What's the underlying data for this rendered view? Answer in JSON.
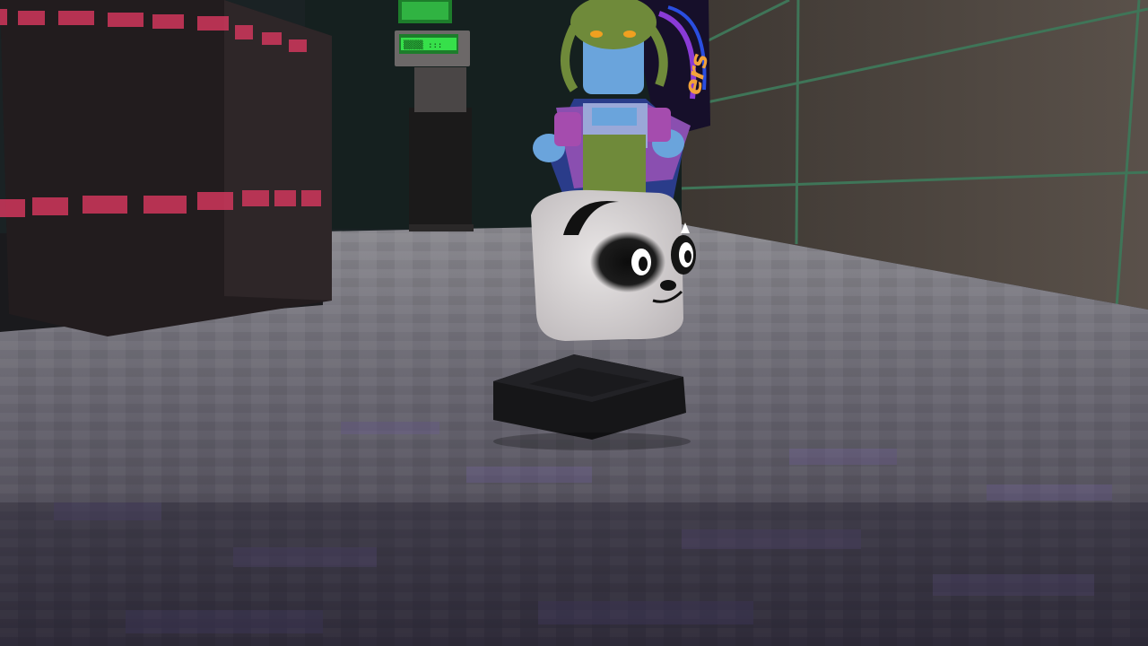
{
  "scene": {
    "poster_fragment_text": "ers",
    "monitor_readout": "▒▒▒▒ :::"
  },
  "colors": {
    "floor_light": "#7b7a82",
    "floor_dark": "#3a3842",
    "floor_purple": "#5e5378",
    "wall_right": "#4a423c",
    "wall_green_line": "#3d6b52",
    "pillar_left": "#231d1f",
    "pillar_stripe": "#d23a5f",
    "back_wall": "#1c2a2c",
    "monitor_green": "#37e84b",
    "panda_white": "#d9d6d6",
    "panda_black": "#111111",
    "pad_black": "#161618",
    "character_skin": "#6aa4dc",
    "character_hair": "#6f8a3a",
    "character_robe": "#8a4fb0"
  },
  "icons": {
    "panda_character": "panda-block-icon",
    "platform": "spawn-pad-icon",
    "npc": "npc-character-icon"
  }
}
